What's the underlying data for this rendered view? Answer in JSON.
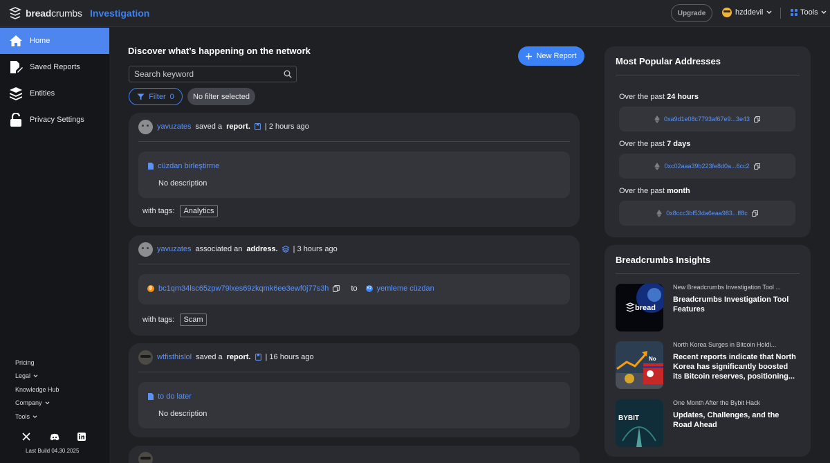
{
  "app": {
    "logo_bold": "bread",
    "logo_light": "crumbs",
    "section_title": "Investigation"
  },
  "topbar": {
    "upgrade_label": "Upgrade",
    "username": "hzddevil",
    "tools_label": "Tools"
  },
  "sidebar": {
    "items": [
      {
        "label": "Home",
        "icon": "home-icon",
        "active": true
      },
      {
        "label": "Saved Reports",
        "icon": "saved-reports-icon",
        "active": false
      },
      {
        "label": "Entities",
        "icon": "layers-icon",
        "active": false
      },
      {
        "label": "Privacy Settings",
        "icon": "lock-icon",
        "active": false
      }
    ],
    "footer_links": [
      {
        "label": "Pricing",
        "has_chevron": false
      },
      {
        "label": "Legal",
        "has_chevron": true
      },
      {
        "label": "Knowledge Hub",
        "has_chevron": false
      },
      {
        "label": "Company",
        "has_chevron": true
      },
      {
        "label": "Tools",
        "has_chevron": true
      }
    ],
    "social": [
      "x-icon",
      "discord-icon",
      "linkedin-icon"
    ],
    "last_build": "Last Build 04.30.2025"
  },
  "feed": {
    "title": "Discover what’s happening on the network",
    "new_report_label": "New Report",
    "search_placeholder": "Search keyword",
    "filter_label": "Filter",
    "filter_count": "0",
    "filter_chip": "No filter selected",
    "tags_label": "with tags:",
    "cards": [
      {
        "user": "yavuzates",
        "verb": "saved a",
        "object": "report.",
        "time": "| 2 hours ago",
        "item_name": "cüzdan birleştirme",
        "description": "No description",
        "tag": "Analytics"
      },
      {
        "user": "yavuzates",
        "verb": "associated an",
        "object": "address.",
        "time": "| 3 hours ago",
        "address": "bc1qm34lsc65zpw79lxes69zkqmk6ee3ewf0j77s3h",
        "to_label": "to",
        "entity_badge": "Y2",
        "entity_name": "yemleme cüzdan",
        "tag": "Scam"
      },
      {
        "user": "wtfisthislol",
        "verb": "saved a",
        "object": "report.",
        "time": "| 16 hours ago",
        "item_name": "to do later",
        "description": "No description"
      }
    ]
  },
  "popular": {
    "title": "Most Popular Addresses",
    "periods": [
      {
        "prefix": "Over the past",
        "bold": "24 hours",
        "address": "0xa9d1e08c7793af67e9...3e43"
      },
      {
        "prefix": "Over the past",
        "bold": "7 days",
        "address": "0xc02aaa39b223fe8d0a...6cc2"
      },
      {
        "prefix": "Over the past",
        "bold": "month",
        "address": "0x8ccc3bf53da6eaa983...ff8c"
      }
    ]
  },
  "insights": {
    "title": "Breadcrumbs Insights",
    "items": [
      {
        "kicker": "New Breadcrumbs Investigation Tool ...",
        "headline": "Breadcrumbs Investigation Tool Features",
        "thumb_text": "bread"
      },
      {
        "kicker": "North Korea Surges in Bitcoin Holdi...",
        "headline": "Recent reports indicate that North Korea has significantly boosted its Bitcoin reserves, positioning...",
        "thumb_text": "No"
      },
      {
        "kicker": "One Month After the Bybit Hack",
        "headline": "Updates, Challenges, and the Road Ahead",
        "thumb_text": "BYBIT"
      }
    ]
  },
  "colors": {
    "accent": "#3b82f6",
    "sidebar_active": "#4e86f0",
    "card_bg": "#2a2b30",
    "page_bg": "#1f2024"
  }
}
